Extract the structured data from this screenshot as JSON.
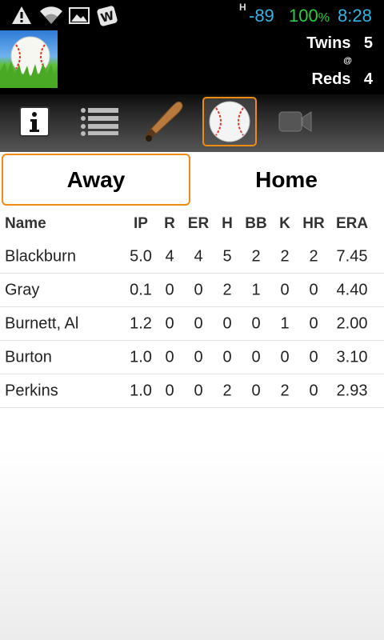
{
  "status_bar": {
    "network_type": "H",
    "signal": "-89",
    "battery_value": "100",
    "battery_unit": "%",
    "time": "8:28",
    "icons": [
      "warning-icon",
      "wifi-icon",
      "image-icon",
      "w-app-icon"
    ]
  },
  "header": {
    "logo_icon": "baseball-on-grass-icon",
    "away_team": "Twins",
    "away_score": "5",
    "at_symbol": "@",
    "home_team": "Reds",
    "home_score": "4"
  },
  "toolbar": {
    "tools": [
      "info-icon",
      "list-icon",
      "bat-icon",
      "baseball-icon",
      "video-camera-icon"
    ],
    "selected": "baseball-icon"
  },
  "tabs": {
    "away_label": "Away",
    "home_label": "Home",
    "selected": "Away"
  },
  "table": {
    "headers": [
      "Name",
      "IP",
      "R",
      "ER",
      "H",
      "BB",
      "K",
      "HR",
      "ERA"
    ],
    "rows": [
      [
        "Blackburn",
        "5.0",
        "4",
        "4",
        "5",
        "2",
        "2",
        "2",
        "7.45"
      ],
      [
        "Gray",
        "0.1",
        "0",
        "0",
        "2",
        "1",
        "0",
        "0",
        "4.40"
      ],
      [
        "Burnett, Al",
        "1.2",
        "0",
        "0",
        "0",
        "0",
        "1",
        "0",
        "2.00"
      ],
      [
        "Burton",
        "1.0",
        "0",
        "0",
        "0",
        "0",
        "0",
        "0",
        "3.10"
      ],
      [
        "Perkins",
        "1.0",
        "0",
        "0",
        "2",
        "0",
        "2",
        "0",
        "2.93"
      ]
    ]
  },
  "colors": {
    "accent": "#f08a10",
    "status_blue": "#33b5e5",
    "battery_green": "#2ecc40"
  }
}
